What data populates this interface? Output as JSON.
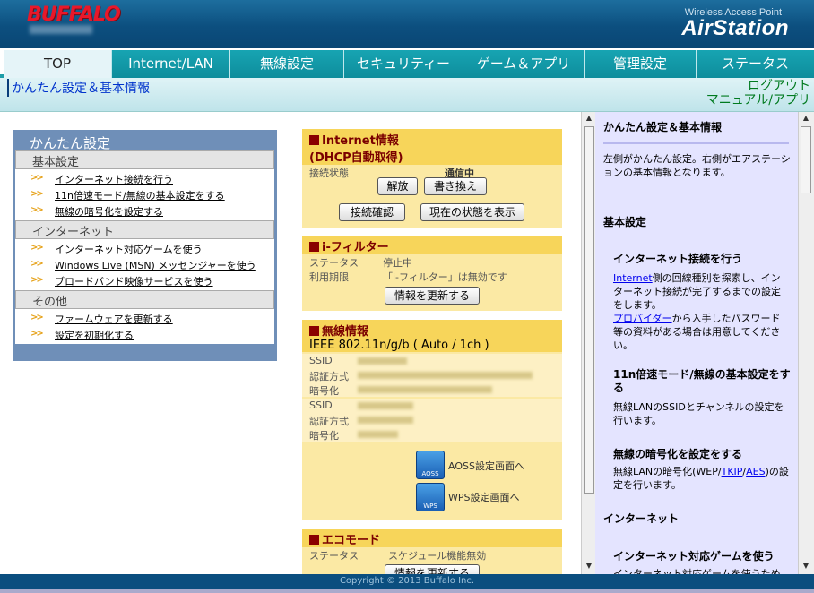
{
  "header": {
    "logo": "BUFFALO",
    "tagline": "Wireless Access Point",
    "brand": "AirStation"
  },
  "nav": {
    "tabs": [
      "TOP",
      "Internet/LAN",
      "無線設定",
      "セキュリティー",
      "ゲーム＆アプリ",
      "管理設定",
      "ステータス"
    ],
    "active": "TOP"
  },
  "subbar": {
    "breadcrumb": "かんたん設定＆基本情報",
    "logout": "ログアウト",
    "manual": "マニュアル/アプリ"
  },
  "easy_setup": {
    "title": "かんたん設定",
    "sections": [
      {
        "heading": "基本設定",
        "links": [
          "インターネット接続を行う",
          "11n倍速モード/無線の基本設定をする",
          "無線の暗号化を設定する"
        ]
      },
      {
        "heading": "インターネット",
        "links": [
          "インターネット対応ゲームを使う",
          "Windows Live (MSN) メッセンジャーを使う",
          "ブロードバンド映像サービスを使う"
        ]
      },
      {
        "heading": "その他",
        "links": [
          "ファームウェアを更新する",
          "設定を初期化する"
        ]
      }
    ]
  },
  "internet_info": {
    "title": "Internet情報",
    "subtitle": "(DHCP自動取得)",
    "status_label": "接続状態",
    "status_value": "通信中",
    "btn_release": "解放",
    "btn_renew": "書き換え",
    "btn_check": "接続確認",
    "btn_show": "現在の状態を表示"
  },
  "ifilter": {
    "title": "i-フィルター",
    "status_label": "ステータス",
    "status_value": "停止中",
    "period_label": "利用期限",
    "period_value": "「i-フィルター」は無効です",
    "btn_update": "情報を更新する"
  },
  "wireless_info": {
    "title": "無線情報",
    "standard": "IEEE 802.11n/g/b ( Auto / 1ch )",
    "labels1": [
      "SSID",
      "認証方式",
      "暗号化"
    ],
    "labels2": [
      "SSID",
      "認証方式",
      "暗号化"
    ],
    "aoss_label": "AOSS設定画面へ",
    "aoss_icon_text": "AOSS",
    "wps_label": "WPS設定画面へ",
    "wps_icon_text": "WPS"
  },
  "eco": {
    "title": "エコモード",
    "status_label": "ステータス",
    "status_value": "スケジュール機能無効",
    "btn_update": "情報を更新する"
  },
  "help": {
    "title": "かんたん設定＆基本情報",
    "intro": "左側がかんたん設定。右側がエアステーションの基本情報となります。",
    "sec_basic": "基本設定",
    "item1_title": "インターネット接続を行う",
    "item1_link": "Internet",
    "item1_text": "側の回線種別を探索し、インターネット接続が完了するまでの設定をします。",
    "item1_link2": "プロバイダー",
    "item1_text2": "から入手したパスワード等の資料がある場合は用意してください。",
    "item2_title": "11n倍速モード/無線の基本設定をする",
    "item2_text": "無線LANのSSIDとチャンネルの設定を行います。",
    "item3_title": "無線の暗号化を設定をする",
    "item3_text_a": "無線LANの暗号化(WEP/",
    "item3_link_a": "TKIP",
    "item3_text_b": "/",
    "item3_link_b": "AES",
    "item3_text_c": ")の設定を行います。",
    "sec_internet": "インターネット",
    "item4_title": "インターネット対応ゲームを使う",
    "item4_text": "インターネット対応ゲームを使うため"
  },
  "footer": {
    "copyright": "Copyright © 2013 Buffalo Inc."
  }
}
